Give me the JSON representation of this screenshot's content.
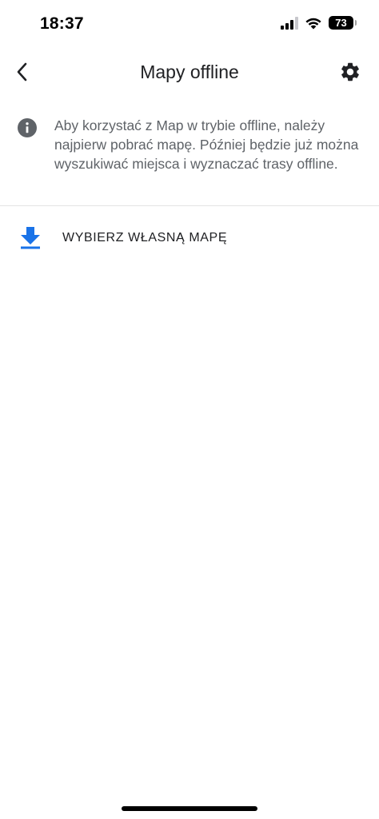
{
  "status_bar": {
    "time": "18:37",
    "battery": "73",
    "icons": [
      "signal-icon",
      "wifi-icon",
      "battery-icon"
    ]
  },
  "app_bar": {
    "title": "Mapy offline",
    "back_icon": "chevron-left-icon",
    "settings_icon": "gear-icon"
  },
  "info": {
    "icon": "info-icon",
    "text": "Aby korzystać z Map w trybie offline, należy najpierw pobrać mapę. Później będzie już można wyszukiwać miejsca i wyznaczać trasy offline."
  },
  "action": {
    "icon": "download-icon",
    "label": "WYBIERZ WŁASNĄ MAPĘ"
  },
  "colors": {
    "accent": "#1a73e8",
    "icon_grey": "#5f6368",
    "text": "#202124"
  }
}
